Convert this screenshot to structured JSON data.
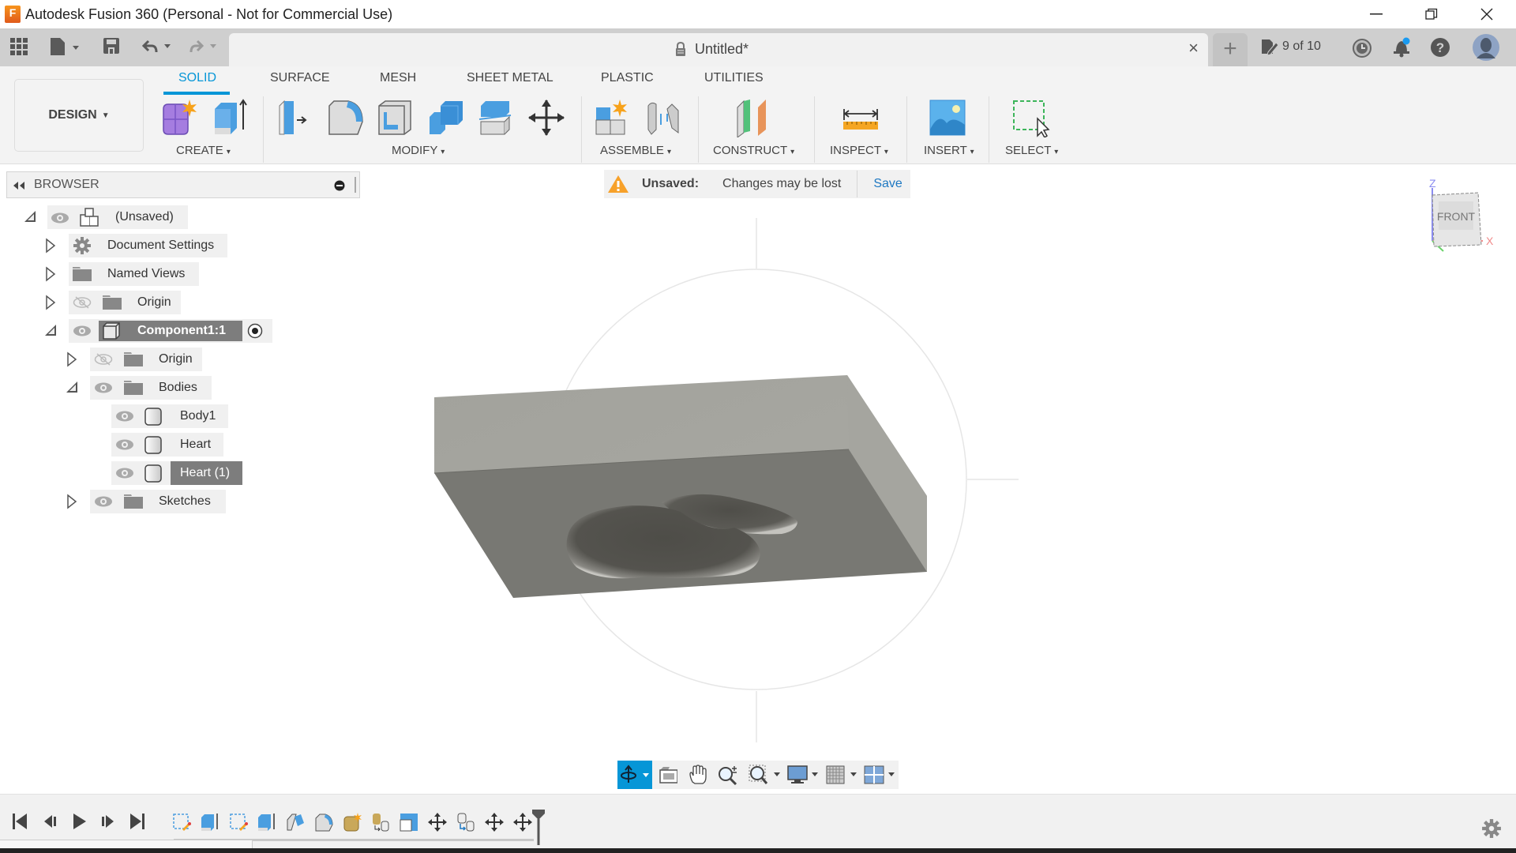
{
  "window": {
    "title": "Autodesk Fusion 360 (Personal - Not for Commercial Use)",
    "logo_letter": "F",
    "controls": [
      "minimize",
      "restore",
      "close"
    ]
  },
  "quick_access": {
    "icons": [
      "apps-grid-icon",
      "file-icon",
      "save-icon",
      "undo-icon",
      "redo-icon"
    ]
  },
  "document_tab": {
    "title": "Untitled*",
    "close_label": "×",
    "new_tab_label": "+"
  },
  "header_right": {
    "job_status": "9 of 10",
    "icons": [
      "job-status-icon",
      "history-clock-icon",
      "notifications-bell-icon",
      "help-icon",
      "user-avatar"
    ]
  },
  "ribbon": {
    "workspace": "DESIGN",
    "tabs": [
      {
        "label": "SOLID",
        "active": true
      },
      {
        "label": "SURFACE",
        "active": false
      },
      {
        "label": "MESH",
        "active": false
      },
      {
        "label": "SHEET METAL",
        "active": false
      },
      {
        "label": "PLASTIC",
        "active": false
      },
      {
        "label": "UTILITIES",
        "active": false
      }
    ],
    "groups": [
      {
        "label": "CREATE",
        "tools": [
          "new-component-icon",
          "extrude-icon"
        ]
      },
      {
        "label": "MODIFY",
        "tools": [
          "press-pull-icon",
          "fillet-icon",
          "shell-icon",
          "combine-icon",
          "split-body-icon",
          "move-copy-icon"
        ]
      },
      {
        "label": "ASSEMBLE",
        "tools": [
          "new-component-assemble-icon",
          "joint-icon"
        ]
      },
      {
        "label": "CONSTRUCT",
        "tools": [
          "offset-plane-icon"
        ]
      },
      {
        "label": "INSPECT",
        "tools": [
          "measure-icon"
        ]
      },
      {
        "label": "INSERT",
        "tools": [
          "insert-image-icon"
        ]
      },
      {
        "label": "SELECT",
        "tools": [
          "select-window-icon"
        ]
      }
    ],
    "dropdown_glyph": "▾",
    "accent": "#0696d7"
  },
  "browser": {
    "title": "BROWSER",
    "tree": [
      {
        "label": "(Unsaved)",
        "expanded": true,
        "level": 0,
        "visible": true,
        "icon": "document-icon"
      },
      {
        "label": "Document Settings",
        "expanded": false,
        "level": 1,
        "icon": "gear-icon"
      },
      {
        "label": "Named Views",
        "expanded": false,
        "level": 1,
        "icon": "folder-icon"
      },
      {
        "label": "Origin",
        "expanded": false,
        "level": 1,
        "visible": false,
        "icon": "folder-icon"
      },
      {
        "label": "Component1:1",
        "expanded": true,
        "level": 1,
        "visible": true,
        "icon": "component-icon",
        "selected": true,
        "active_radio": true
      },
      {
        "label": "Origin",
        "expanded": false,
        "level": 2,
        "visible": false,
        "icon": "folder-icon"
      },
      {
        "label": "Bodies",
        "expanded": true,
        "level": 2,
        "visible": true,
        "icon": "folder-icon"
      },
      {
        "label": "Body1",
        "level": 3,
        "visible": true,
        "icon": "body-icon"
      },
      {
        "label": "Heart",
        "level": 3,
        "visible": true,
        "icon": "body-icon"
      },
      {
        "label": "Heart (1)",
        "level": 3,
        "visible": true,
        "icon": "body-icon",
        "selected": true
      },
      {
        "label": "Sketches",
        "expanded": false,
        "level": 2,
        "visible": true,
        "icon": "folder-icon"
      }
    ]
  },
  "unsaved_banner": {
    "title": "Unsaved:",
    "message": "Changes may be lost",
    "action": "Save",
    "warning_color": "#f7a12a",
    "action_color": "#1e78c2"
  },
  "viewcube": {
    "face": "FRONT",
    "axes": {
      "x": "X",
      "y": "Y",
      "z": "Z"
    }
  },
  "nav_toolbar": {
    "tools": [
      "orbit-icon",
      "look-at-icon",
      "pan-icon",
      "zoom-icon",
      "fit-icon",
      "display-settings-icon",
      "grid-settings-icon",
      "viewports-icon"
    ]
  },
  "timeline": {
    "controls": [
      "go-to-start-icon",
      "step-back-icon",
      "play-icon",
      "step-forward-icon",
      "go-to-end-icon"
    ],
    "features": [
      "sketch",
      "extrude",
      "sketch",
      "extrude",
      "press-pull",
      "fillet",
      "form",
      "combine",
      "shell",
      "move",
      "combine",
      "move",
      "move"
    ],
    "settings_icon": "gear-icon"
  }
}
